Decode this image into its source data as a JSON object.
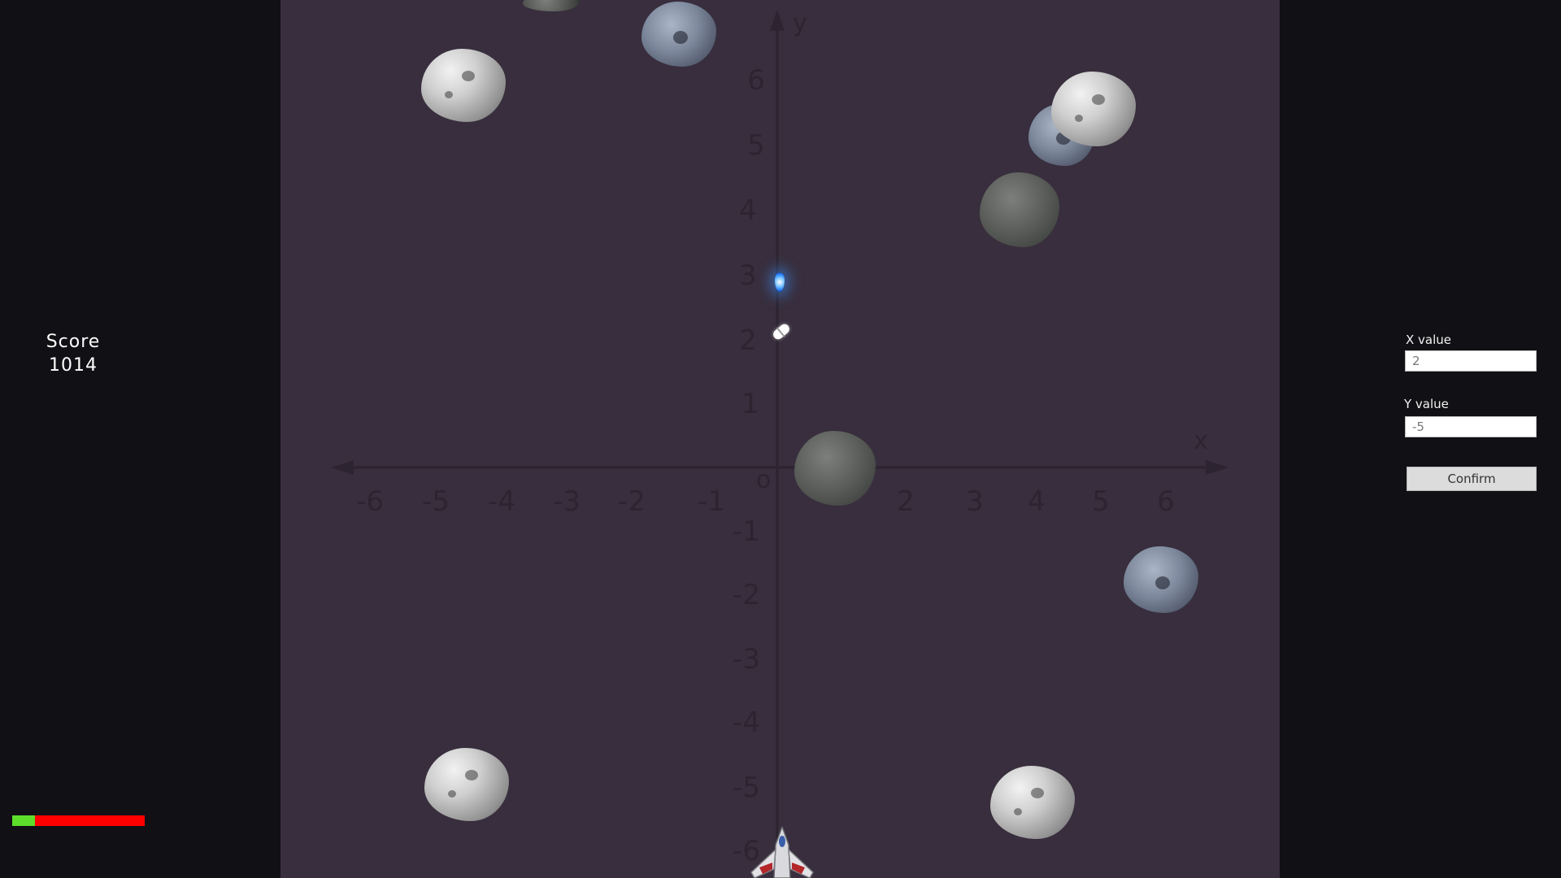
{
  "score": {
    "label": "Score",
    "value": "1014"
  },
  "health": {
    "fraction": 0.17,
    "fill_color": "#5dde2a",
    "empty_color": "#ff0000"
  },
  "graph": {
    "axis_x_label": "x",
    "axis_y_label": "y",
    "origin_label": "o",
    "x_ticks": [
      "-6",
      "-5",
      "-4",
      "-3",
      "-2",
      "-1",
      "2",
      "3",
      "4",
      "5",
      "6"
    ],
    "y_ticks": [
      "6",
      "5",
      "4",
      "3",
      "2",
      "1",
      "-1",
      "-2",
      "-3",
      "-4",
      "-5",
      "-6"
    ]
  },
  "controls": {
    "x_label": "X value",
    "x_value": "2",
    "y_label": "Y value",
    "y_value": "-5",
    "confirm_label": "Confirm"
  },
  "colors": {
    "playfield": "#382e3d",
    "background": "#111014",
    "projectile": "#1e78ff"
  }
}
